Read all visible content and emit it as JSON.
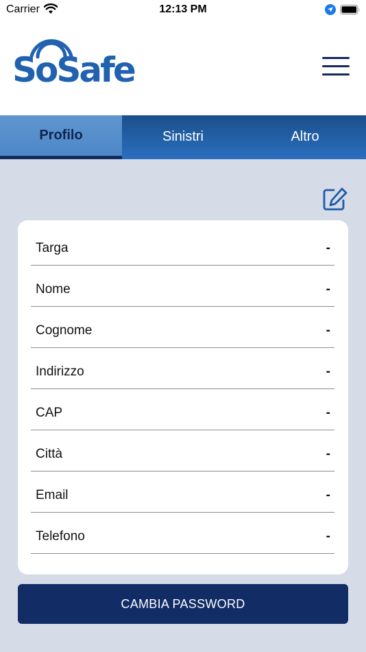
{
  "status_bar": {
    "carrier": "Carrier",
    "time": "12:13 PM"
  },
  "header": {
    "logo_text": "SoSafe",
    "brand_color": "#2062b0",
    "menu_icon": "hamburger-menu-icon"
  },
  "tabs": [
    {
      "label": "Profilo",
      "active": true
    },
    {
      "label": "Sinistri",
      "active": false
    },
    {
      "label": "Altro",
      "active": false
    }
  ],
  "profile": {
    "edit_icon": "edit-icon",
    "fields": [
      {
        "label": "Targa",
        "value": "-"
      },
      {
        "label": "Nome",
        "value": "-"
      },
      {
        "label": "Cognome",
        "value": "-"
      },
      {
        "label": "Indirizzo",
        "value": "-"
      },
      {
        "label": "CAP",
        "value": "-"
      },
      {
        "label": "Città",
        "value": "-"
      },
      {
        "label": "Email",
        "value": "-"
      },
      {
        "label": "Telefono",
        "value": "-"
      }
    ]
  },
  "actions": {
    "change_password_label": "CAMBIA PASSWORD"
  },
  "colors": {
    "navy": "#122c66",
    "background": "#d5dbe7",
    "tab_gradient_top": "#1b4f8c",
    "tab_gradient_bottom": "#2a6fbe"
  }
}
